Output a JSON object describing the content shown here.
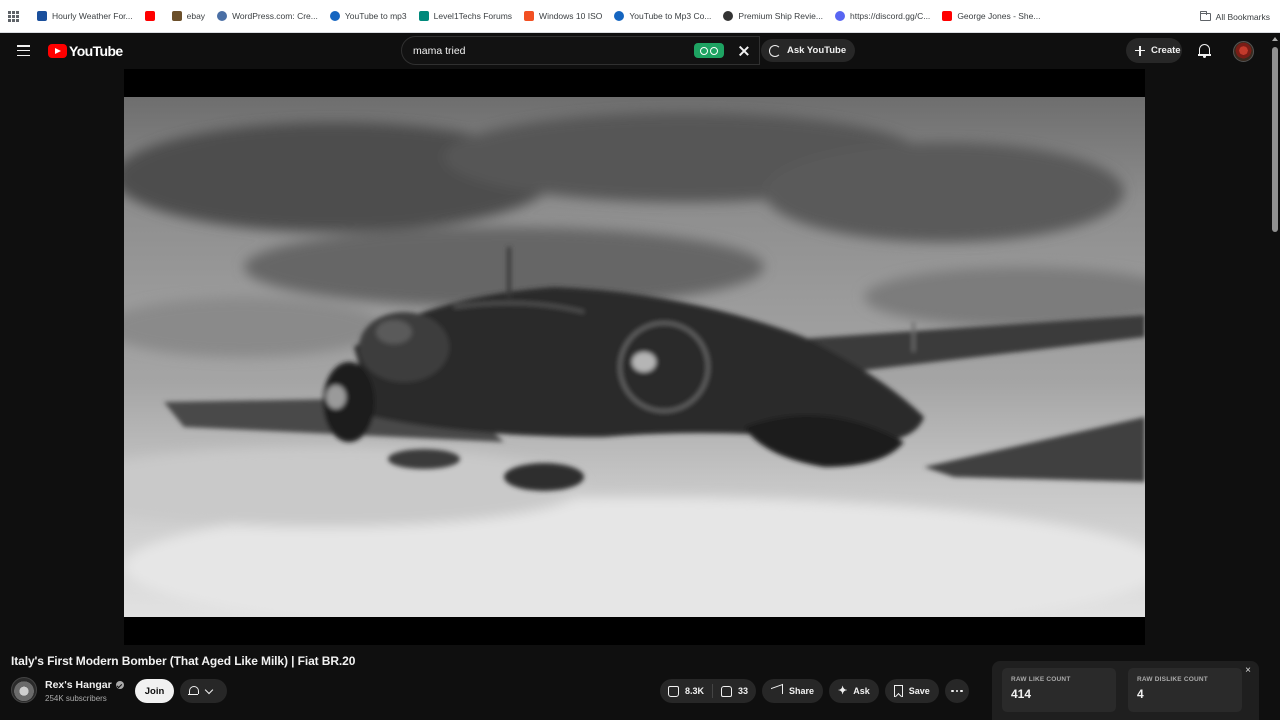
{
  "bookmarks": [
    {
      "label": "Hourly Weather For...",
      "color": "#1a4f9c",
      "icon": "weather-icon"
    },
    {
      "label": "",
      "color": "#ff0000",
      "icon": "youtube-icon"
    },
    {
      "label": "ebay",
      "color": "#6b4f2a",
      "icon": "ebay-icon"
    },
    {
      "label": "WordPress.com: Cre...",
      "color": "#4a6fa5",
      "icon": "wordpress-icon"
    },
    {
      "label": "YouTube to mp3",
      "color": "#1565c0",
      "icon": "converter-icon"
    },
    {
      "label": "Level1Techs Forums",
      "color": "#00897b",
      "icon": "level1-icon"
    },
    {
      "label": "Windows 10 ISO",
      "color": "#f25022",
      "icon": "windows-icon"
    },
    {
      "label": "YouTube to Mp3 Co...",
      "color": "#1565c0",
      "icon": "converter-icon"
    },
    {
      "label": "Premium Ship Revie...",
      "color": "#333333",
      "icon": "ship-icon"
    },
    {
      "label": "https://discord.gg/C...",
      "color": "#5865f2",
      "icon": "discord-icon"
    },
    {
      "label": "George Jones - She...",
      "color": "#ff0000",
      "icon": "youtube-icon"
    }
  ],
  "all_bookmarks": "All Bookmarks",
  "header": {
    "logo_text": "YouTube",
    "search_value": "mama tried",
    "ask_label": "Ask YouTube",
    "create_label": "Create"
  },
  "video": {
    "title": "Italy's First Modern Bomber (That Aged Like Milk) | Fiat BR.20",
    "channel": "Rex's Hangar",
    "subscribers": "254K subscribers",
    "join_label": "Join",
    "likes": "8.3K",
    "dislikes": "33",
    "share_label": "Share",
    "ask_label": "Ask",
    "save_label": "Save"
  },
  "raw_counts": {
    "like_label": "RAW LIKE COUNT",
    "like_value": "414",
    "dislike_label": "RAW DISLIKE COUNT",
    "dislike_value": "4",
    "close": "×"
  },
  "colors": {
    "brand": "#ff0000",
    "background": "#0f0f0f",
    "pill": "#272727"
  }
}
